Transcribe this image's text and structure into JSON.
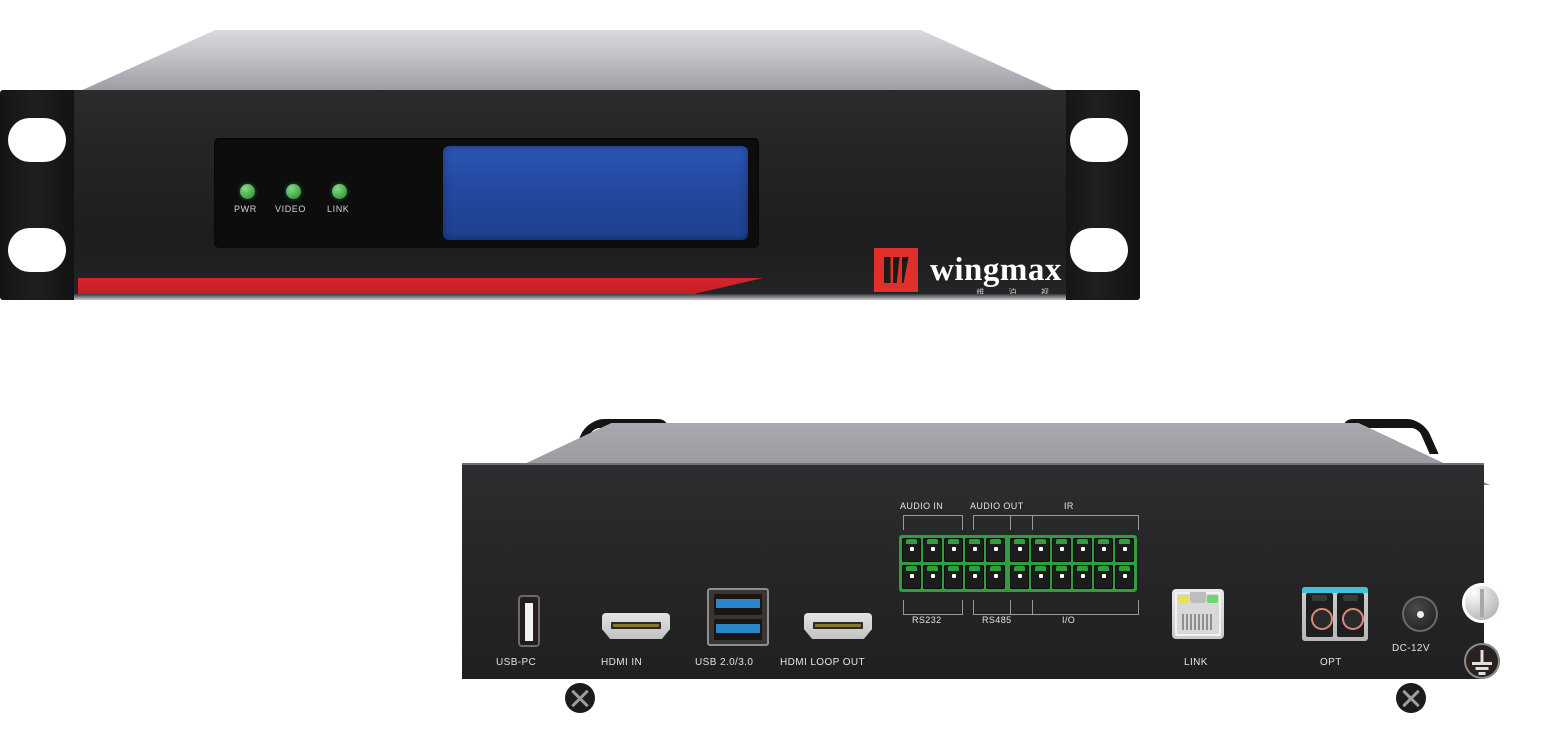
{
  "product": {
    "brand_name": "wingmax",
    "brand_sub": "维 泊 视",
    "brand_mark_color": "#e0302c",
    "accent_stripe_color": "#c01d26",
    "chassis_color": "#232325",
    "lid_color": "#b9bbc0"
  },
  "front_panel": {
    "leds": [
      {
        "label": "PWR",
        "color": "#4caf50"
      },
      {
        "label": "VIDEO",
        "color": "#4caf50"
      },
      {
        "label": "LINK",
        "color": "#4caf50"
      }
    ],
    "display": {
      "name": "lcd-screen",
      "color": "#23499f",
      "text": ""
    }
  },
  "rear_panel": {
    "ports": [
      {
        "label": "USB-PC",
        "type": "usb-b"
      },
      {
        "label": "HDMI IN",
        "type": "hdmi"
      },
      {
        "label": "USB 2.0/3.0",
        "type": "usb-a-stack"
      },
      {
        "label": "HDMI LOOP OUT",
        "type": "hdmi"
      },
      {
        "label": "LINK",
        "type": "rj45"
      },
      {
        "label": "OPT",
        "type": "fiber-lc"
      },
      {
        "label": "DC-12V",
        "type": "dc-jack"
      }
    ],
    "terminal_blocks": [
      {
        "name": "audio-serial-block",
        "top_labels": [
          "AUDIO IN",
          "AUDIO OUT"
        ],
        "bottom_labels": [
          "RS232",
          "RS485"
        ],
        "pins_per_group": 3,
        "rows": 2,
        "color": "#2f9e3f"
      },
      {
        "name": "ir-io-block",
        "top_labels": [
          "IR"
        ],
        "bottom_labels": [
          "I/O"
        ],
        "pins_per_group": 6,
        "rows": 2,
        "color": "#2f9e3f"
      }
    ],
    "ground_symbol_label": "",
    "screws": 2
  }
}
